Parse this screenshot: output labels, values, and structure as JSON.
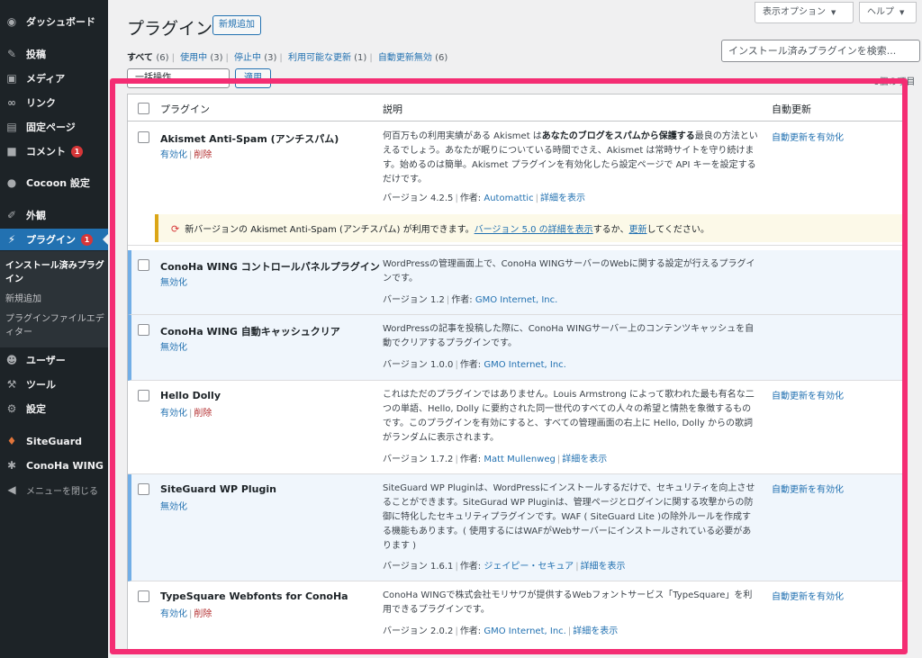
{
  "sidebar": {
    "items": [
      {
        "icon": "dashboard-icon",
        "glyph": "◉",
        "label": "ダッシュボード"
      },
      {
        "icon": "pin-icon",
        "glyph": "✎",
        "label": "投稿"
      },
      {
        "icon": "media-icon",
        "glyph": "▣",
        "label": "メディア"
      },
      {
        "icon": "link-icon",
        "glyph": "∞",
        "label": "リンク"
      },
      {
        "icon": "page-icon",
        "glyph": "▤",
        "label": "固定ページ"
      },
      {
        "icon": "comment-icon",
        "glyph": "■",
        "label": "コメント",
        "badge": "1"
      },
      {
        "icon": "cocoon-icon",
        "glyph": "●",
        "label": "Cocoon 設定"
      },
      {
        "icon": "appearance-icon",
        "glyph": "✐",
        "label": "外観"
      },
      {
        "icon": "plugin-icon",
        "glyph": "⚡",
        "label": "プラグイン",
        "badge": "1"
      },
      {
        "icon": "user-icon",
        "glyph": "☻",
        "label": "ユーザー"
      },
      {
        "icon": "tool-icon",
        "glyph": "⚒",
        "label": "ツール"
      },
      {
        "icon": "settings-icon",
        "glyph": "⚙",
        "label": "設定"
      },
      {
        "icon": "siteguard-icon",
        "glyph": "♦",
        "label": "SiteGuard"
      },
      {
        "icon": "conoha-icon",
        "glyph": "✱",
        "label": "ConoHa WING"
      },
      {
        "icon": "collapse-icon",
        "glyph": "◀",
        "label": "メニューを閉じる"
      }
    ],
    "submenu": [
      "インストール済みプラグイン",
      "新規追加",
      "プラグインファイルエディター"
    ]
  },
  "header": {
    "title": "プラグイン",
    "add_new": "新規追加",
    "screen_options": "表示オプション",
    "help": "ヘルプ",
    "search_placeholder": "インストール済みプラグインを検索...",
    "bulk_action": "一括操作",
    "apply": "適用",
    "items_count": "6個の項目"
  },
  "filters": [
    {
      "label": "すべて",
      "count": "(6)"
    },
    {
      "label": "使用中",
      "count": "(3)"
    },
    {
      "label": "停止中",
      "count": "(3)"
    },
    {
      "label": "利用可能な更新",
      "count": "(1)"
    },
    {
      "label": "自動更新無効",
      "count": "(6)"
    }
  ],
  "table": {
    "col_plugin": "プラグイン",
    "col_description": "説明",
    "col_auto_update": "自動更新",
    "plugins": [
      {
        "name": "Akismet Anti-Spam (アンチスパム)",
        "action1": "有効化",
        "action2": "削除",
        "desc_pre": "何百万もの利用実績がある Akismet は",
        "desc_bold": "あなたのブログをスパムから保護する",
        "desc_post": "最良の方法といえるでしょう。あなたが眠りについている時間でさえ、Akismet は常時サイトを守り続けます。始めるのは簡単。Akismet プラグインを有効化したら設定ページで API キーを設定するだけです。",
        "version": "バージョン 4.2.5",
        "by": "作者:",
        "author": "Automattic",
        "details": "詳細を表示",
        "auto": "自動更新を有効化"
      },
      {
        "name": "ConoHa WING コントロールパネルプラグイン",
        "action1": "無効化",
        "desc": "WordPressの管理画面上で、ConoHa WINGサーバーのWebに関する設定が行えるプラグインです。",
        "version": "バージョン 1.2",
        "by": "作者:",
        "author": "GMO Internet, Inc."
      },
      {
        "name": "ConoHa WING 自動キャッシュクリア",
        "action1": "無効化",
        "desc": "WordPressの記事を投稿した際に、ConoHa WINGサーバー上のコンテンツキャッシュを自動でクリアするプラグインです。",
        "version": "バージョン 1.0.0",
        "by": "作者:",
        "author": "GMO Internet, Inc."
      },
      {
        "name": "Hello Dolly",
        "action1": "有効化",
        "action2": "削除",
        "desc": "これはただのプラグインではありません。Louis Armstrong によって歌われた最も有名な二つの単語、Hello, Dolly に要約された同一世代のすべての人々の希望と情熱を象徴するものです。このプラグインを有効にすると、すべての管理画面の右上に Hello, Dolly からの歌詞がランダムに表示されます。",
        "version": "バージョン 1.7.2",
        "by": "作者:",
        "author": "Matt Mullenweg",
        "details": "詳細を表示",
        "auto": "自動更新を有効化"
      },
      {
        "name": "SiteGuard WP Plugin",
        "action1": "無効化",
        "desc": "SiteGuard WP Pluginは、WordPressにインストールするだけで、セキュリティを向上させることができます。SiteGurad WP Pluginは、管理ページとログインに関する攻撃からの防御に特化したセキュリティプラグインです。WAF ( SiteGuard Lite )の除外ルールを作成する機能もあります。( 使用するにはWAFがWebサーバーにインストールされている必要があります )",
        "version": "バージョン 1.6.1",
        "by": "作者:",
        "author": "ジェイピー・セキュア",
        "details": "詳細を表示",
        "auto": "自動更新を有効化"
      },
      {
        "name": "TypeSquare Webfonts for ConoHa",
        "action1": "有効化",
        "action2": "削除",
        "desc": "ConoHa WINGで株式会社モリサワが提供するWebフォントサービス「TypeSquare」を利用できるプラグインです。",
        "version": "バージョン 2.0.2",
        "by": "作者:",
        "author": "GMO Internet, Inc.",
        "details": "詳細を表示",
        "auto": "自動更新を有効化"
      }
    ],
    "update_notice": {
      "pre": "新バージョンの Akismet Anti-Spam (アンチスパム) が利用できます。",
      "link1": "バージョン 5.0 の詳細を表示",
      "mid": "するか、",
      "link2": "更新",
      "post": "してください。"
    }
  },
  "colors": {
    "accent": "#2271b1",
    "highlight": "#f42d73",
    "sidebar_bg": "#1d2327",
    "delete": "#b32d2e"
  }
}
